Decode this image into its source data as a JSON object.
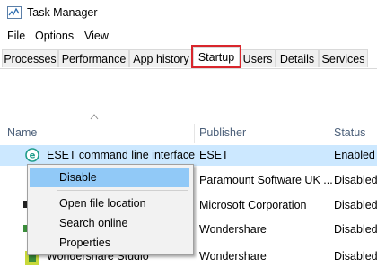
{
  "window": {
    "title": "Task Manager"
  },
  "menu": [
    "File",
    "Options",
    "View"
  ],
  "tabs": [
    "Processes",
    "Performance",
    "App history",
    "Startup",
    "Users",
    "Details",
    "Services"
  ],
  "active_tab": "Startup",
  "columns": {
    "name": "Name",
    "publisher": "Publisher",
    "status": "Status"
  },
  "rows": [
    {
      "name": "ESET command line interface",
      "publisher": "ESET",
      "status": "Enabled",
      "icon": "eset-icon"
    },
    {
      "name": "",
      "publisher": "Paramount Software UK ...",
      "status": "Disabled",
      "icon": ""
    },
    {
      "name": "",
      "publisher": "Microsoft Corporation",
      "status": "Disabled",
      "icon": "app-icon"
    },
    {
      "name": "",
      "publisher": "Wondershare",
      "status": "Disabled",
      "icon": "app-icon"
    },
    {
      "name": "Wondershare Studio",
      "publisher": "Wondershare",
      "status": "Disabled",
      "icon": "wondershare-icon"
    }
  ],
  "context_menu": [
    "Disable",
    "Open file location",
    "Search online",
    "Properties"
  ],
  "colors": {
    "accent_highlight": "#d9262c",
    "selection": "#cce8ff",
    "menu_hover": "#91c9f7"
  }
}
